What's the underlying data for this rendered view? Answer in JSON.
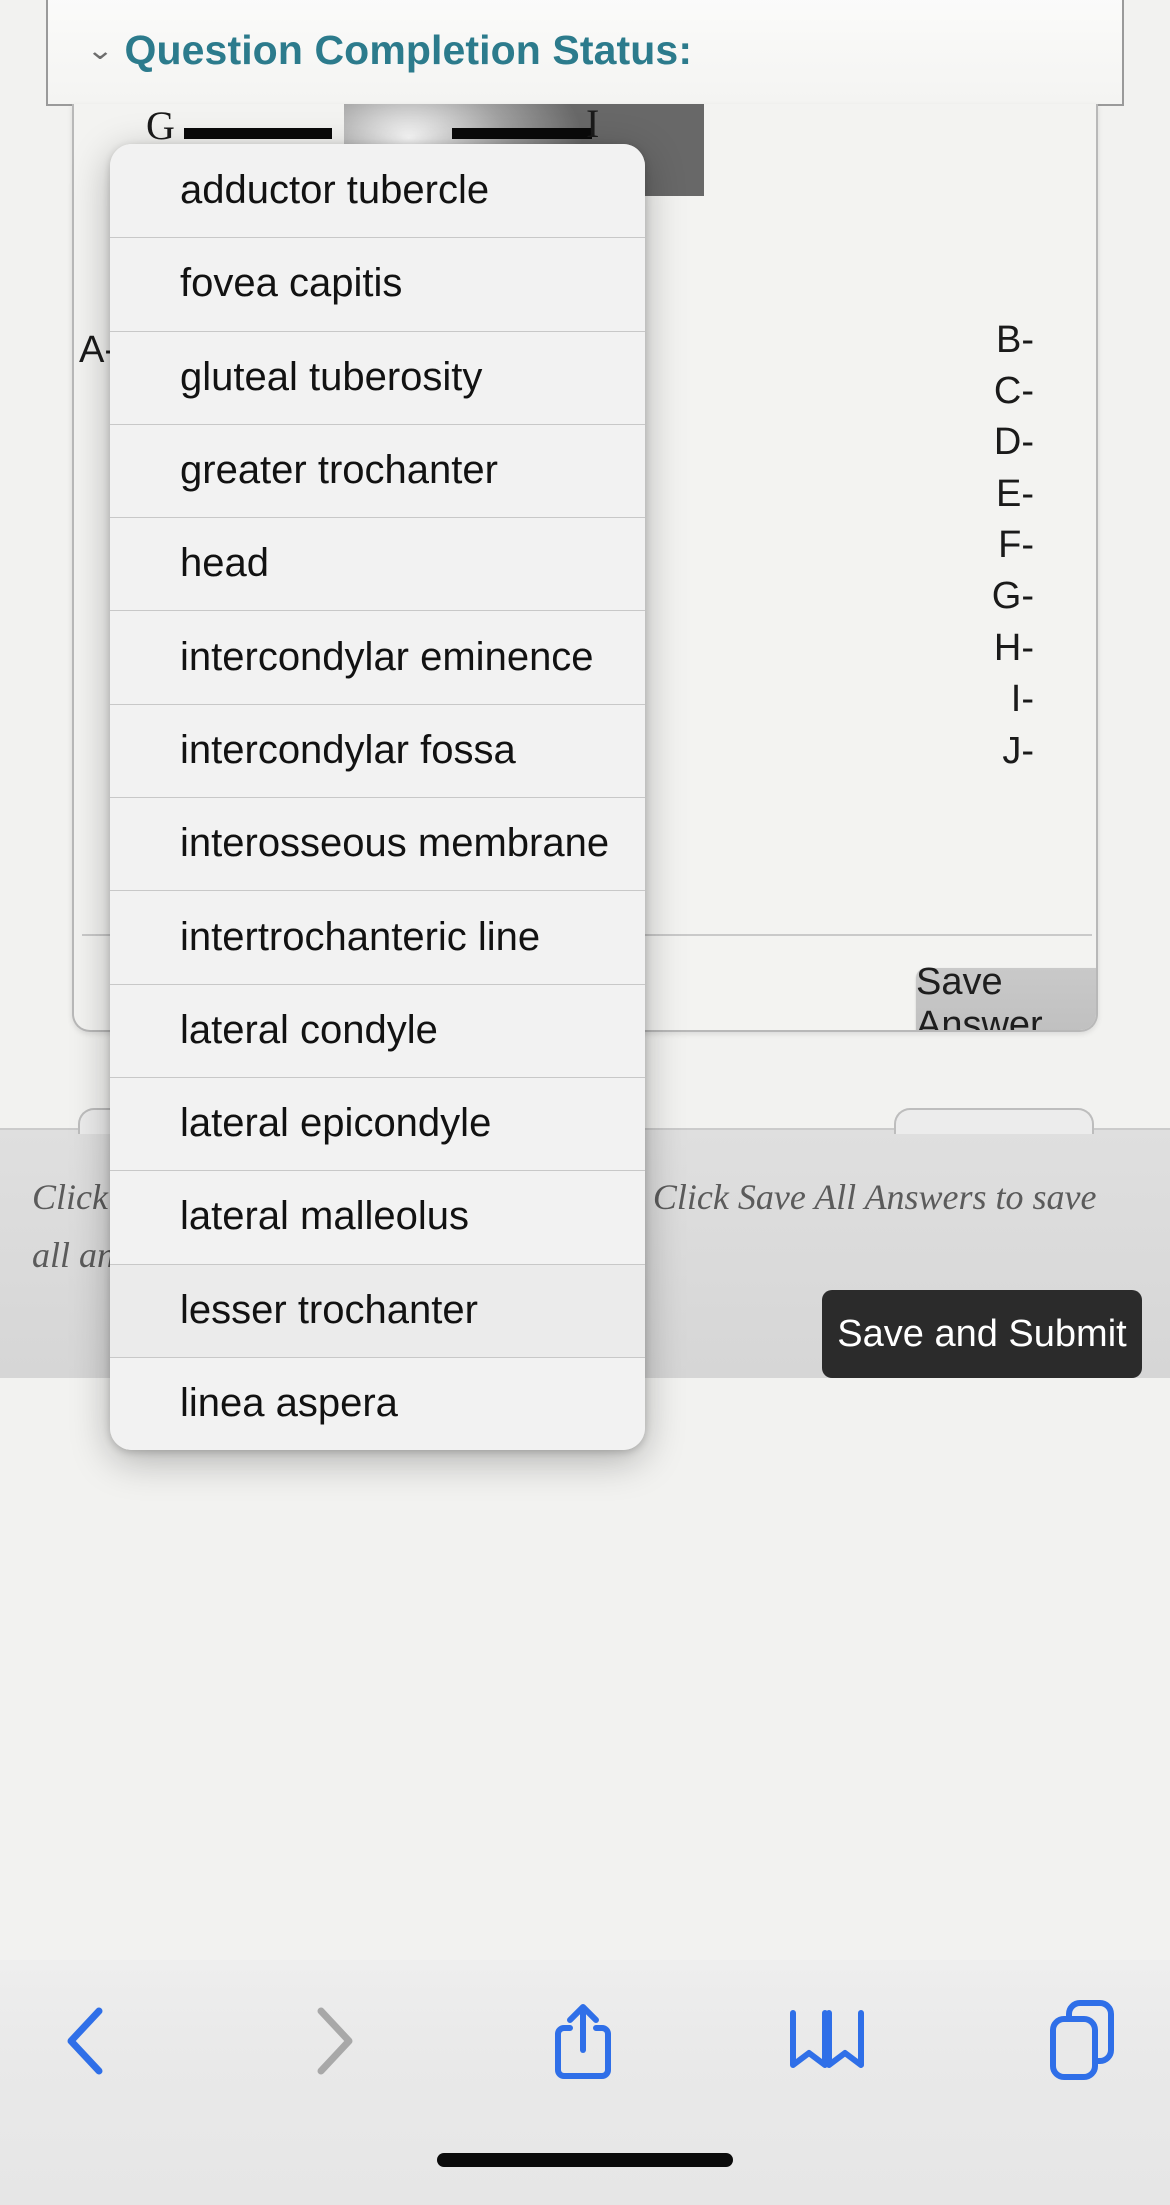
{
  "header": {
    "chevron_icon": "double-chevron-down-icon",
    "title": "Question Completion Status:"
  },
  "question": {
    "figure": {
      "image_alt": "grayscale femur bone photograph",
      "left_label": "G",
      "right_label": "I"
    },
    "left_labels": [
      "A-"
    ],
    "right_labels": [
      "B-",
      "C-",
      "D-",
      "E-",
      "F-",
      "G-",
      "H-",
      "I-",
      "J-"
    ],
    "save_answer_label": "Save Answer"
  },
  "bottom": {
    "hint": "Click Save and Submit to save and submit. Click Save All Answers to save all answers.",
    "hint_visible_left": "Click Sav",
    "hint_visible_right": "s to save all",
    "hint_line2": "answers.",
    "submit_label": "Save and Submit"
  },
  "picker": {
    "selected": "lesser trochanter",
    "options": [
      "adductor tubercle",
      "fovea capitis",
      "gluteal tuberosity",
      "greater trochanter",
      "head",
      "intercondylar eminence",
      "intercondylar fossa",
      "interosseous membrane",
      "intertrochanteric line",
      "lateral condyle",
      "lateral epicondyle",
      "lateral malleolus",
      "lesser trochanter",
      "linea aspera"
    ]
  },
  "safari_toolbar": {
    "back_icon": "chevron-left-icon",
    "forward_icon": "chevron-right-icon",
    "share_icon": "share-up-icon",
    "bookmarks_icon": "book-icon",
    "tabs_icon": "tabs-icon",
    "accent_color": "#2f6fe8",
    "disabled_color": "#a8a8a8"
  }
}
